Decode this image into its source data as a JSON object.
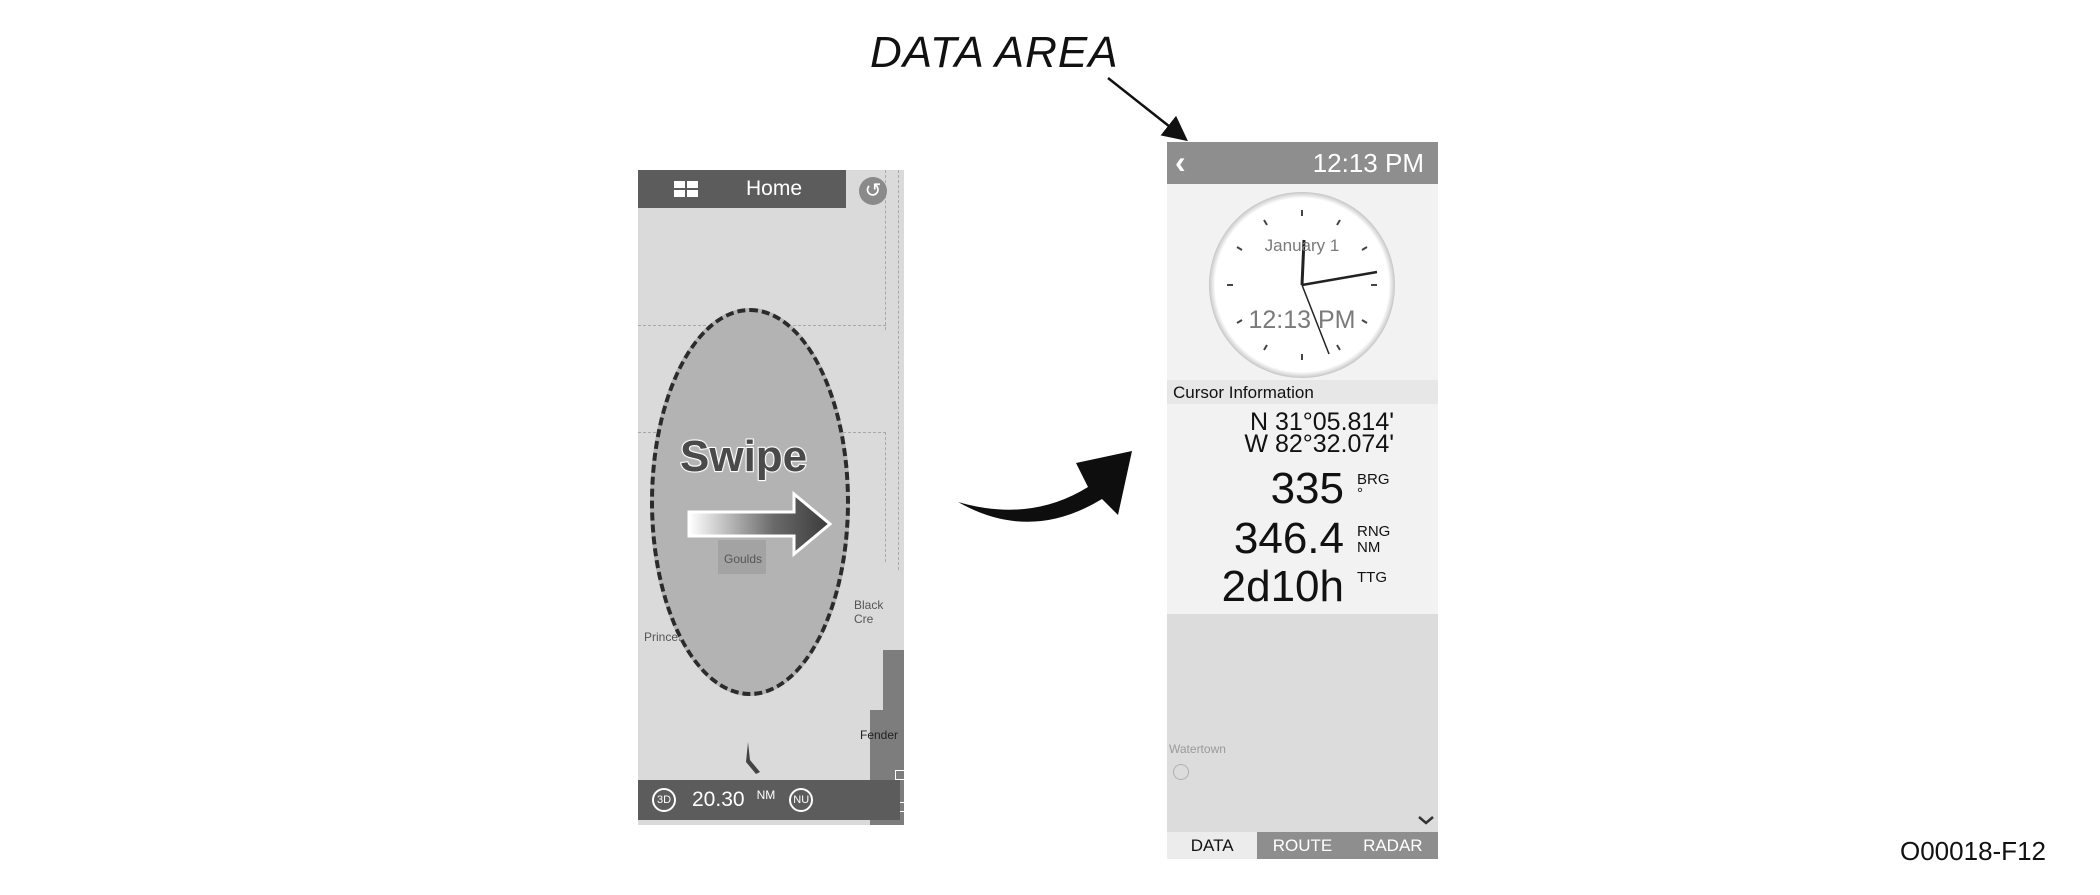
{
  "callout": {
    "label": "DATA AREA"
  },
  "figure_code": "O00018-F12",
  "left_screen": {
    "home_bar": {
      "title": "Home",
      "grid_icon": "grid-layout-icon"
    },
    "undo_icon": "undo-icon",
    "map_labels": {
      "goulds": "Goulds",
      "black_creek": "Black Cre",
      "princeton": "Princeton",
      "fender": "Fender"
    },
    "gesture": {
      "text": "Swipe",
      "direction_icon": "arrow-right-icon"
    },
    "bottom_bar": {
      "mode_3d": "3D",
      "range": "20.30",
      "range_unit": "NM",
      "orientation": "NU"
    }
  },
  "transition_icon": "curved-arrow-icon",
  "right_screen": {
    "top_bar": {
      "back_icon": "chevron-left-icon",
      "time": "12:13 PM"
    },
    "clock": {
      "date": "January 1",
      "time": "12:13 PM"
    },
    "cursor_info": {
      "header": "Cursor Information",
      "lat": "N 31°05.814'",
      "lon": "W 82°32.074'",
      "bearing": {
        "value": "335",
        "label": "BRG",
        "unit": "°"
      },
      "range": {
        "value": "346.4",
        "label": "RNG",
        "unit": "NM"
      },
      "ttg": {
        "value": "2d10h",
        "label": "TTG"
      }
    },
    "map_label": "Watertown",
    "expand_icon": "chevron-down-icon",
    "tabs": [
      {
        "label": "DATA",
        "active": true
      },
      {
        "label": "ROUTE",
        "active": false
      },
      {
        "label": "RADAR",
        "active": false
      }
    ]
  }
}
